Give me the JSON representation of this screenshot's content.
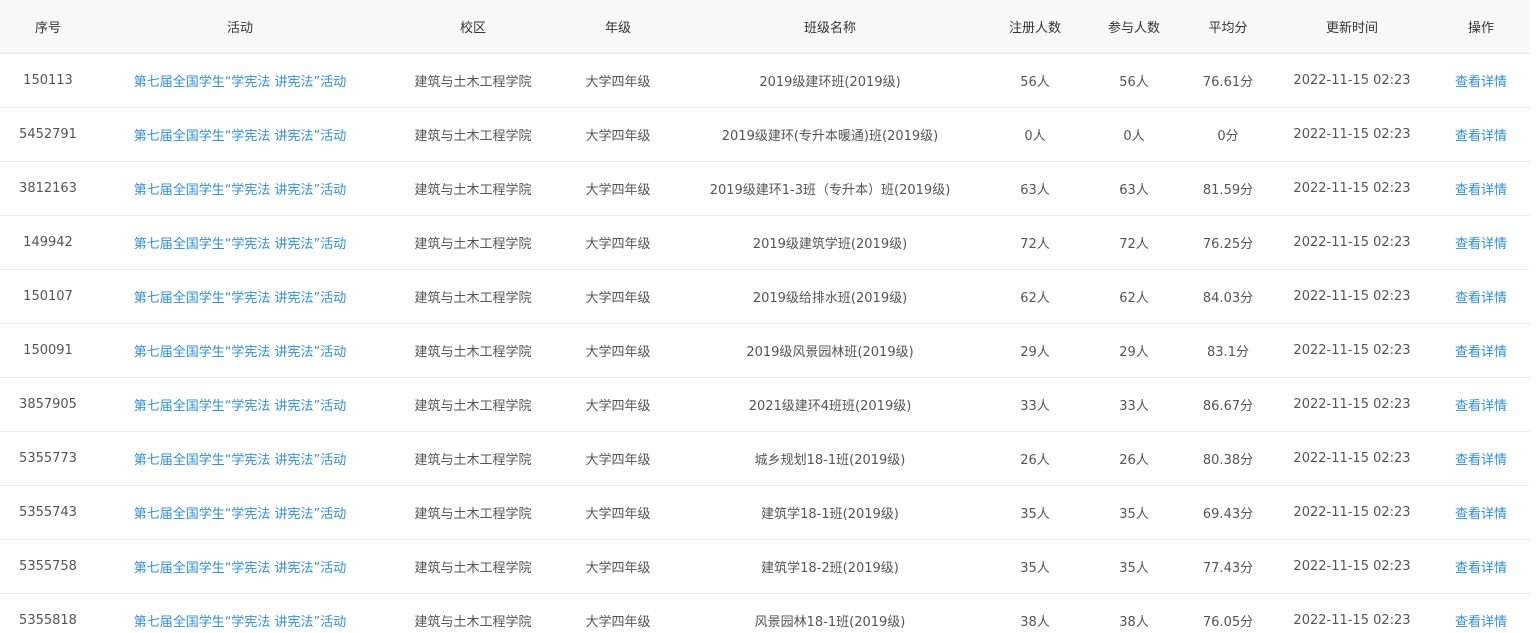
{
  "headers": [
    "序号",
    "活动",
    "校区",
    "年级",
    "班级名称",
    "注册人数",
    "参与人数",
    "平均分",
    "更新时间",
    "操作"
  ],
  "rows": [
    {
      "id": "150113",
      "activity": "第七届全国学生“学宪法 讲宪法”活动",
      "campus": "建筑与土木工程学院",
      "grade": "大学四年级",
      "class_name": "2019级建环班(2019级)",
      "registered": "56人",
      "participants": "56人",
      "avg_score": "76.61分",
      "updated": "2022-11-15 02:23",
      "action": "查看详情"
    },
    {
      "id": "5452791",
      "activity": "第七届全国学生“学宪法 讲宪法”活动",
      "campus": "建筑与土木工程学院",
      "grade": "大学四年级",
      "class_name": "2019级建环(专升本暖通)班(2019级)",
      "registered": "0人",
      "participants": "0人",
      "avg_score": "0分",
      "updated": "2022-11-15 02:23",
      "action": "查看详情"
    },
    {
      "id": "3812163",
      "activity": "第七届全国学生“学宪法 讲宪法”活动",
      "campus": "建筑与土木工程学院",
      "grade": "大学四年级",
      "class_name": "2019级建环1-3班（专升本）班(2019级)",
      "registered": "63人",
      "participants": "63人",
      "avg_score": "81.59分",
      "updated": "2022-11-15 02:23",
      "action": "查看详情"
    },
    {
      "id": "149942",
      "activity": "第七届全国学生“学宪法 讲宪法”活动",
      "campus": "建筑与土木工程学院",
      "grade": "大学四年级",
      "class_name": "2019级建筑学班(2019级)",
      "registered": "72人",
      "participants": "72人",
      "avg_score": "76.25分",
      "updated": "2022-11-15 02:23",
      "action": "查看详情"
    },
    {
      "id": "150107",
      "activity": "第七届全国学生“学宪法 讲宪法”活动",
      "campus": "建筑与土木工程学院",
      "grade": "大学四年级",
      "class_name": "2019级给排水班(2019级)",
      "registered": "62人",
      "participants": "62人",
      "avg_score": "84.03分",
      "updated": "2022-11-15 02:23",
      "action": "查看详情"
    },
    {
      "id": "150091",
      "activity": "第七届全国学生“学宪法 讲宪法”活动",
      "campus": "建筑与土木工程学院",
      "grade": "大学四年级",
      "class_name": "2019级风景园林班(2019级)",
      "registered": "29人",
      "participants": "29人",
      "avg_score": "83.1分",
      "updated": "2022-11-15 02:23",
      "action": "查看详情"
    },
    {
      "id": "3857905",
      "activity": "第七届全国学生“学宪法 讲宪法”活动",
      "campus": "建筑与土木工程学院",
      "grade": "大学四年级",
      "class_name": "2021级建环4班班(2019级)",
      "registered": "33人",
      "participants": "33人",
      "avg_score": "86.67分",
      "updated": "2022-11-15 02:23",
      "action": "查看详情"
    },
    {
      "id": "5355773",
      "activity": "第七届全国学生“学宪法 讲宪法”活动",
      "campus": "建筑与土木工程学院",
      "grade": "大学四年级",
      "class_name": "城乡规划18-1班(2019级)",
      "registered": "26人",
      "participants": "26人",
      "avg_score": "80.38分",
      "updated": "2022-11-15 02:23",
      "action": "查看详情"
    },
    {
      "id": "5355743",
      "activity": "第七届全国学生“学宪法 讲宪法”活动",
      "campus": "建筑与土木工程学院",
      "grade": "大学四年级",
      "class_name": "建筑学18-1班(2019级)",
      "registered": "35人",
      "participants": "35人",
      "avg_score": "69.43分",
      "updated": "2022-11-15 02:23",
      "action": "查看详情"
    },
    {
      "id": "5355758",
      "activity": "第七届全国学生“学宪法 讲宪法”活动",
      "campus": "建筑与土木工程学院",
      "grade": "大学四年级",
      "class_name": "建筑学18-2班(2019级)",
      "registered": "35人",
      "participants": "35人",
      "avg_score": "77.43分",
      "updated": "2022-11-15 02:23",
      "action": "查看详情"
    },
    {
      "id": "5355818",
      "activity": "第七届全国学生“学宪法 讲宪法”活动",
      "campus": "建筑与土木工程学院",
      "grade": "大学四年级",
      "class_name": "风景园林18-1班(2019级)",
      "registered": "38人",
      "participants": "38人",
      "avg_score": "76.05分",
      "updated": "2022-11-15 02:23",
      "action": "查看详情"
    }
  ]
}
